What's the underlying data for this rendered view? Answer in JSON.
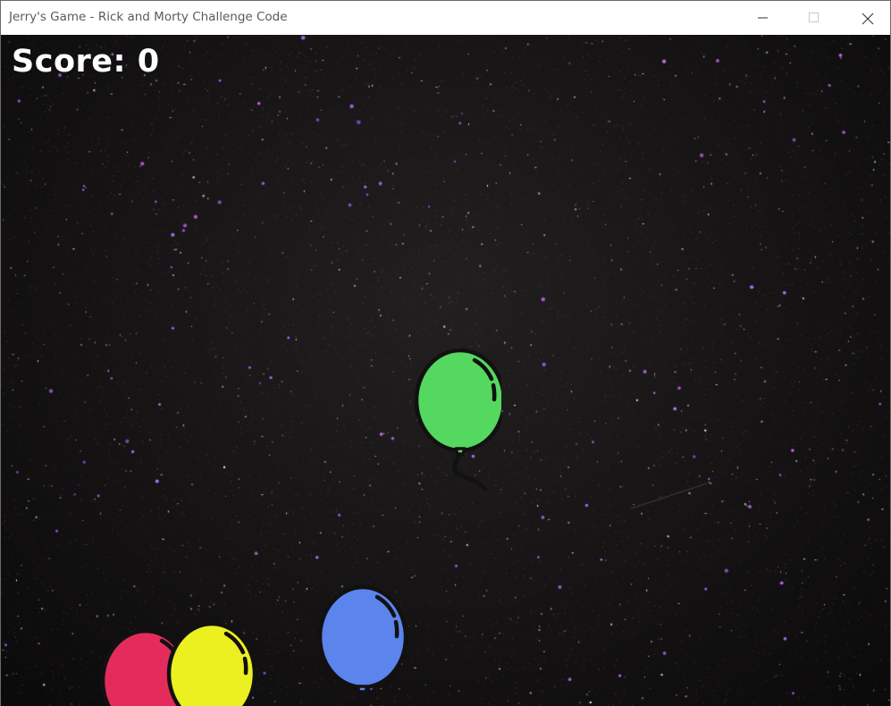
{
  "window": {
    "title": "Jerry's Game - Rick and Morty Challenge Code",
    "controls": [
      "minimize-icon",
      "maximize-icon",
      "close-icon"
    ]
  },
  "hud": {
    "score_label": "Score:",
    "score_value": "0"
  },
  "balloons": [
    {
      "color_name": "green",
      "fill": "#55d85f"
    },
    {
      "color_name": "blue",
      "fill": "#5b84ec"
    },
    {
      "color_name": "red",
      "fill": "#e42c5c"
    },
    {
      "color_name": "yellow",
      "fill": "#ecef20"
    }
  ],
  "colors": {
    "background": "#151314",
    "outline": "#111111",
    "titlebar": "#ffffff",
    "title_text": "#5a5a5a"
  }
}
